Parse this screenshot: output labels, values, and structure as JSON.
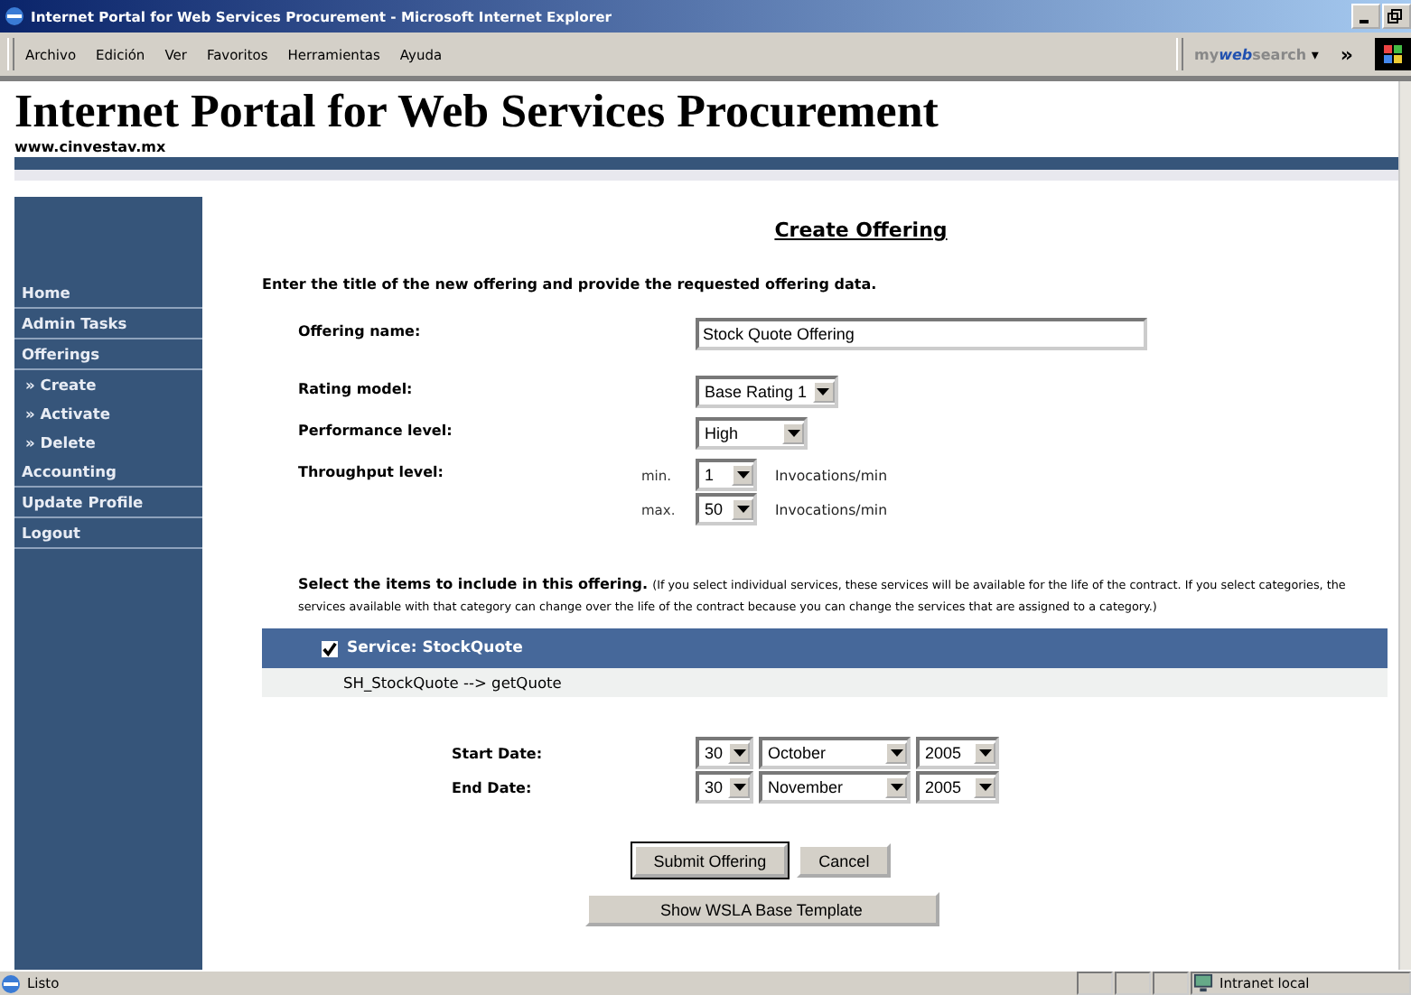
{
  "window": {
    "title": "Internet Portal for Web Services Procurement - Microsoft Internet Explorer"
  },
  "menu": [
    "Archivo",
    "Edición",
    "Ver",
    "Favoritos",
    "Herramientas",
    "Ayuda"
  ],
  "toolbar": {
    "search_brand_prefix": "my",
    "search_brand_bold": "web",
    "search_brand_suffix": "search",
    "search_caret": "▾",
    "chevron": "»"
  },
  "header": {
    "title": "Internet Portal for Web Services Procurement",
    "url": "www.cinvestav.mx"
  },
  "sidebar": {
    "items": [
      {
        "label": "Home"
      },
      {
        "label": "Admin Tasks"
      },
      {
        "label": "Offerings",
        "children": [
          {
            "label": "» Create"
          },
          {
            "label": "» Activate"
          },
          {
            "label": "» Delete"
          }
        ]
      },
      {
        "label": "Accounting"
      },
      {
        "label": "Update Profile"
      },
      {
        "label": "Logout"
      }
    ]
  },
  "form": {
    "title": "Create Offering",
    "intro": "Enter the title of the new offering and provide the requested offering data.",
    "offering_name": {
      "label": "Offering name:",
      "value": "Stock Quote Offering"
    },
    "rating_model": {
      "label": "Rating model:",
      "value": "Base Rating 1"
    },
    "performance_level": {
      "label": "Performance level:",
      "value": "High"
    },
    "throughput": {
      "label": "Throughput level:",
      "min_label": "min.",
      "min_value": "1",
      "max_label": "max.",
      "max_value": "50",
      "unit_min": "Invocations/min",
      "unit_max": "Invocations/min"
    },
    "items_heading": "Select the items to include in this offering.",
    "items_note": "(If you select individual services, these services will be available for the life of the contract. If you select categories, the services available with that category can change over the life of the contract because you can change the services that are assigned to a category.)",
    "service": {
      "label": "Service: StockQuote",
      "checked": true,
      "operation": "SH_StockQuote --> getQuote"
    },
    "dates": [
      {
        "label": "Start Date:",
        "day": "30",
        "month": "October",
        "year": "2005"
      },
      {
        "label": "End Date:",
        "day": "30",
        "month": "November",
        "year": "2005"
      }
    ],
    "buttons": [
      "Submit Offering",
      "Cancel"
    ],
    "template_button": "Show WSLA Base Template"
  },
  "status_bar": {
    "text": "Listo",
    "zone": "Intranet local"
  }
}
